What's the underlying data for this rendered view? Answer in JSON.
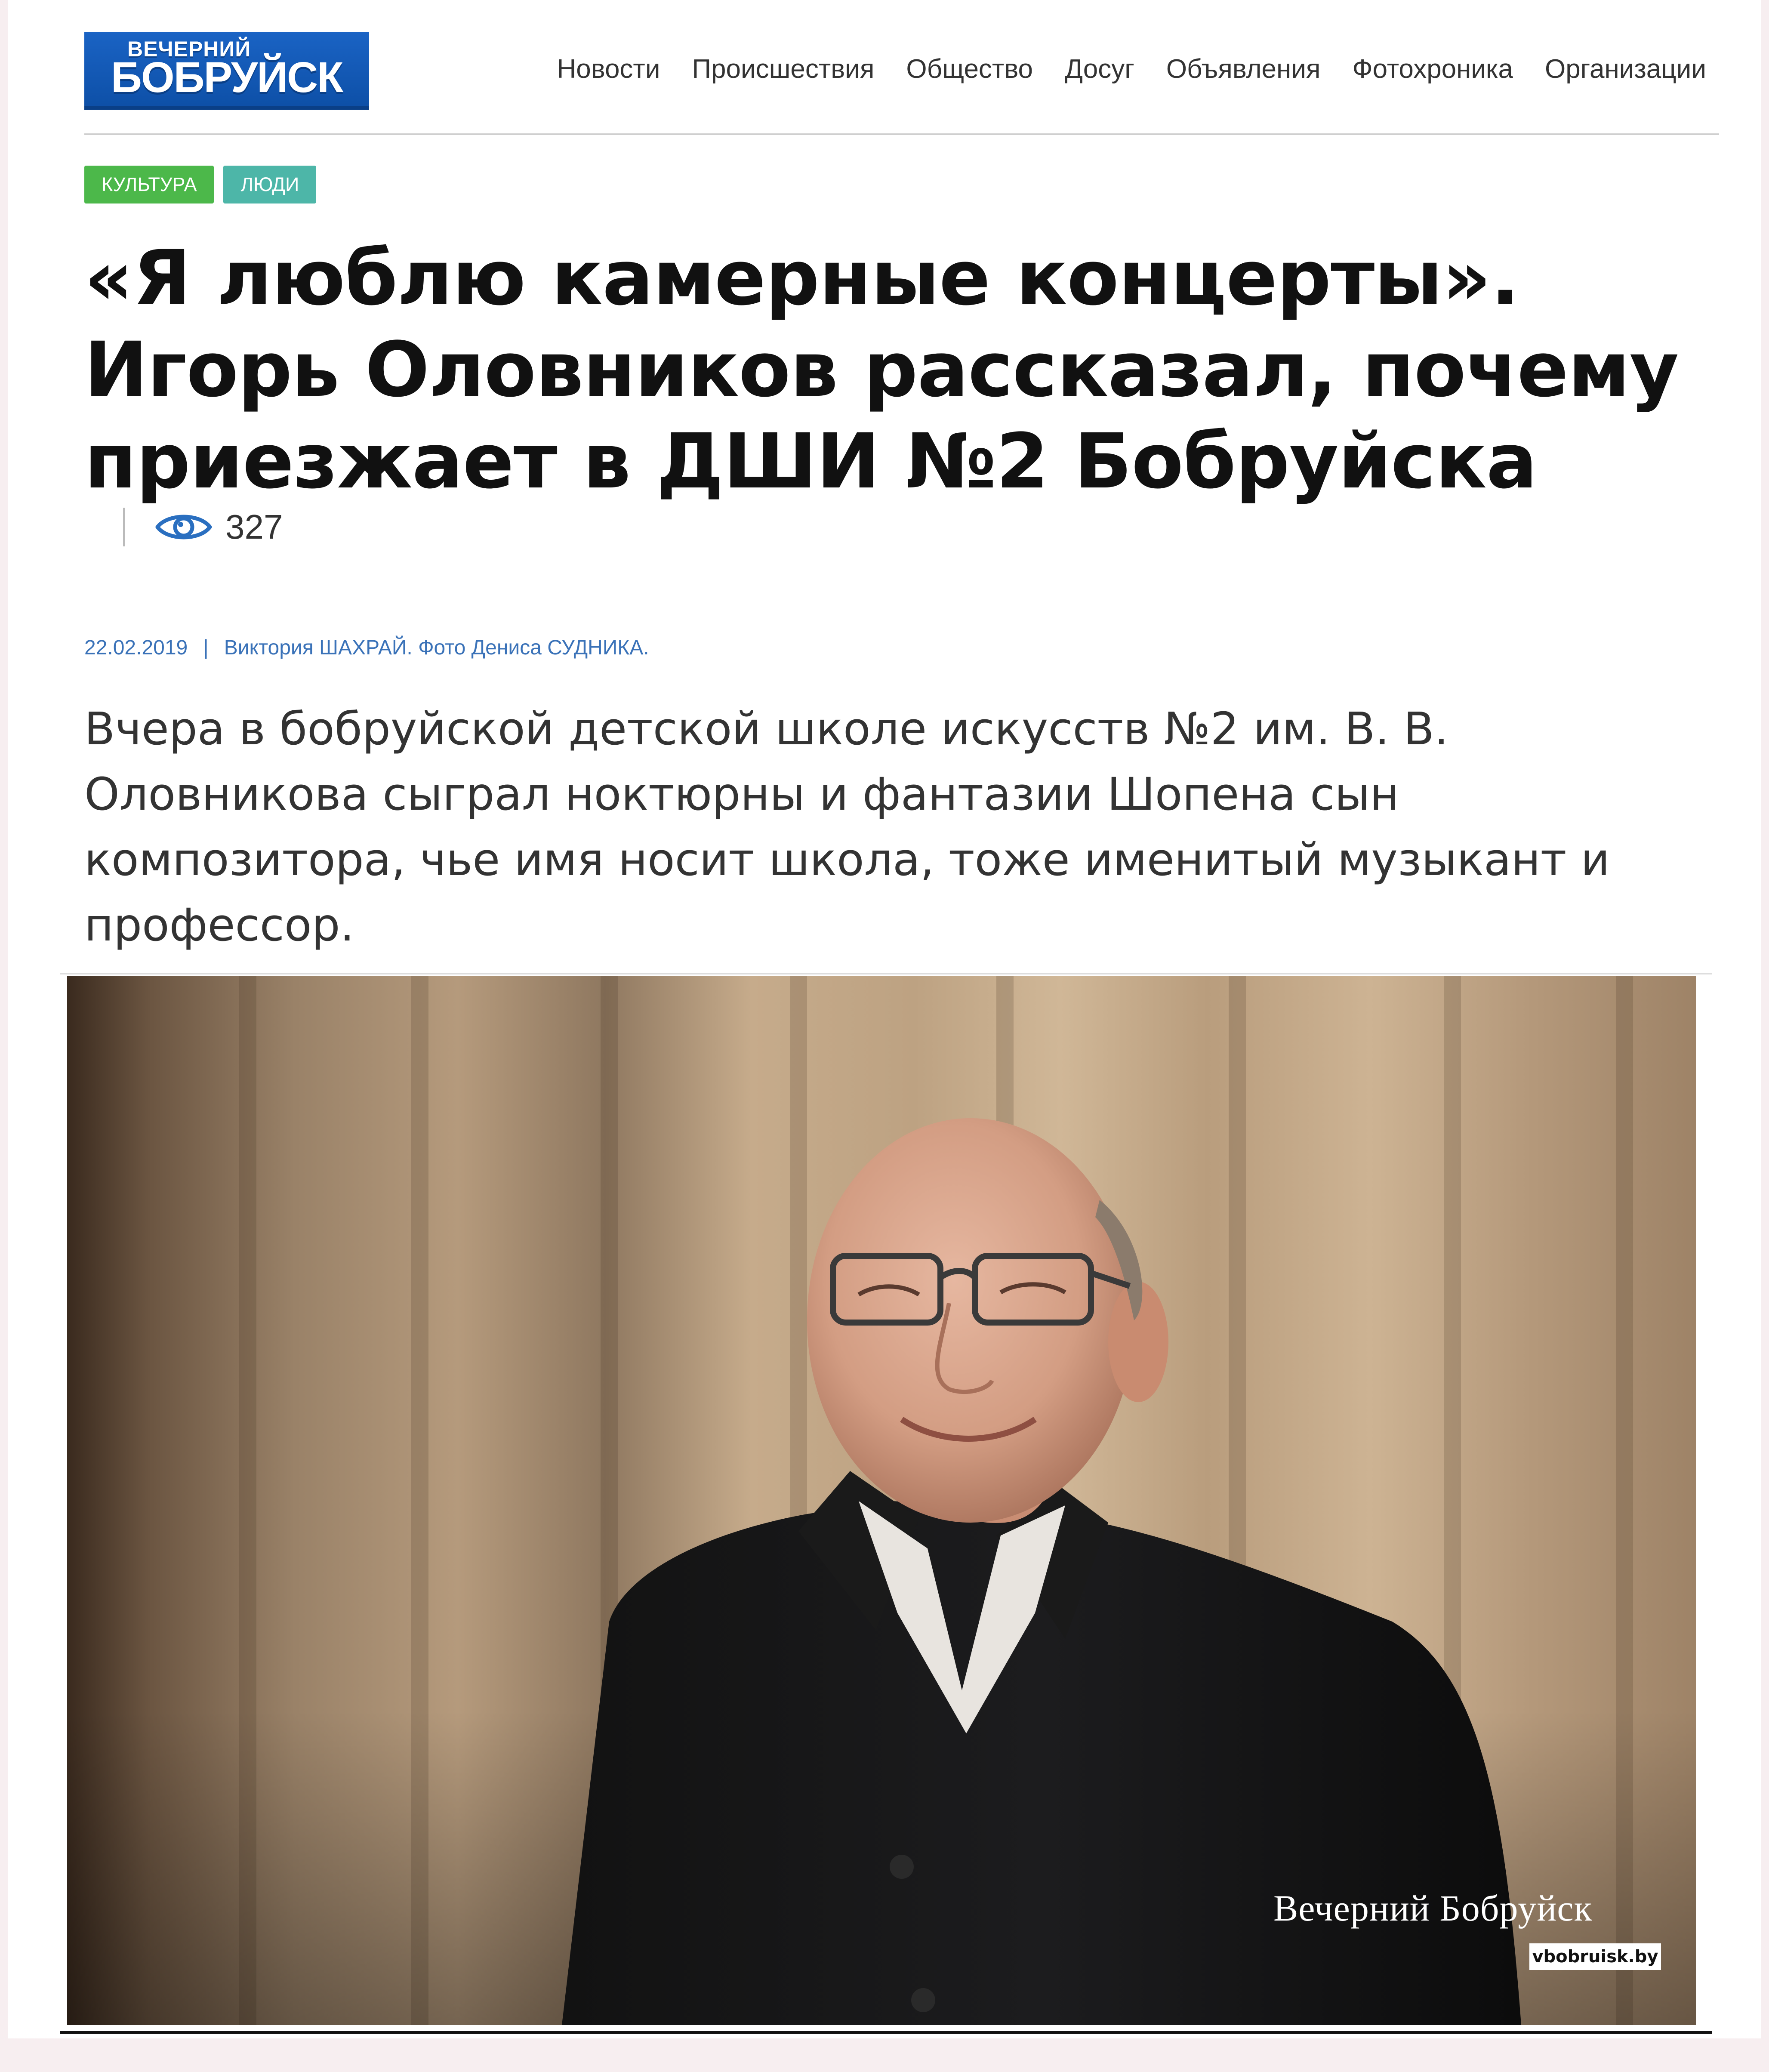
{
  "header": {
    "logo": {
      "top_line": "ВЕЧЕРНИЙ",
      "main_line": "БОБРУЙСК"
    },
    "nav": [
      {
        "label": "Новости"
      },
      {
        "label": "Происшествия"
      },
      {
        "label": "Общество"
      },
      {
        "label": "Досуг"
      },
      {
        "label": "Объявления"
      },
      {
        "label": "Фотохроника"
      },
      {
        "label": "Организации"
      }
    ]
  },
  "tags": [
    {
      "label": "КУЛЬТУРА",
      "color": "#4cb84a"
    },
    {
      "label": "ЛЮДИ",
      "color": "#4db6a8"
    }
  ],
  "article": {
    "title": "«Я люблю камерные концерты». Игорь Оловников рассказал, почему приезжает в ДШИ №2 Бобруйска",
    "views": "327",
    "views_icon": "eye-icon",
    "date": "22.02.2019",
    "meta_separator": "|",
    "author": "Виктория ШАХРАЙ. Фото Дениса СУДНИКА.",
    "lead": "Вчера в бобруйской детской школе искусств №2 им. В. В. Оловникова сыграл ноктюрны и фантазии Шопена сын композитора, чье имя носит школа, тоже именитый музыкант и профессор."
  },
  "photo": {
    "watermark_title": "Вечерний Бобруйск",
    "watermark_url": "vbobruisk.by"
  },
  "colors": {
    "accent_blue": "#1a63c4",
    "meta_blue": "#3a72b8",
    "tag_green": "#4cb84a",
    "tag_teal": "#4db6a8",
    "page_bg": "#f7eef0"
  }
}
